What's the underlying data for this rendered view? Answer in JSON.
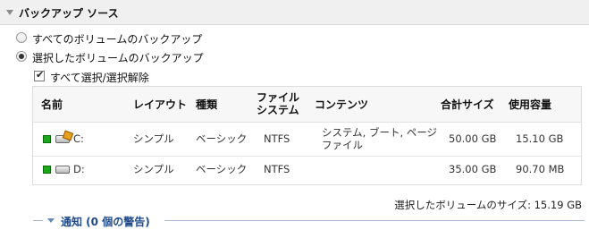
{
  "section": {
    "title": "バックアップ ソース"
  },
  "options": {
    "all_volumes_label": "すべてのボリュームのバックアップ",
    "selected_volumes_label": "選択したボリュームのバックアップ",
    "selected_option": "selected_volumes"
  },
  "select_all": {
    "label": "すべて選択/選択解除",
    "checked": true
  },
  "table": {
    "headers": {
      "name": "名前",
      "layout": "レイアウト",
      "type": "種類",
      "filesystem_line1": "ファイル",
      "filesystem_line2": "システム",
      "contents": "コンテンツ",
      "total_size": "合計サイズ",
      "used": "使用容量"
    },
    "rows": [
      {
        "name": "C:",
        "layout": "シンプル",
        "type": "ベーシック",
        "filesystem": "NTFS",
        "contents_line1": "システム, ブート, ページ",
        "contents_line2": "ファイル",
        "total_size": "50.00 GB",
        "used": "15.10 GB",
        "selected": true,
        "icon": "system-disk-icon"
      },
      {
        "name": "D:",
        "layout": "シンプル",
        "type": "ベーシック",
        "filesystem": "NTFS",
        "contents_line1": "",
        "contents_line2": "",
        "total_size": "35.00 GB",
        "used": "90.70 MB",
        "selected": true,
        "icon": "disk-icon"
      }
    ]
  },
  "summary": {
    "text": "選択したボリュームのサイズ: 15.19 GB"
  },
  "notification": {
    "label": "通知 (0 個の警告)"
  },
  "colors": {
    "accent": "#1f4a8a",
    "selected_indicator": "#1aa81a"
  }
}
